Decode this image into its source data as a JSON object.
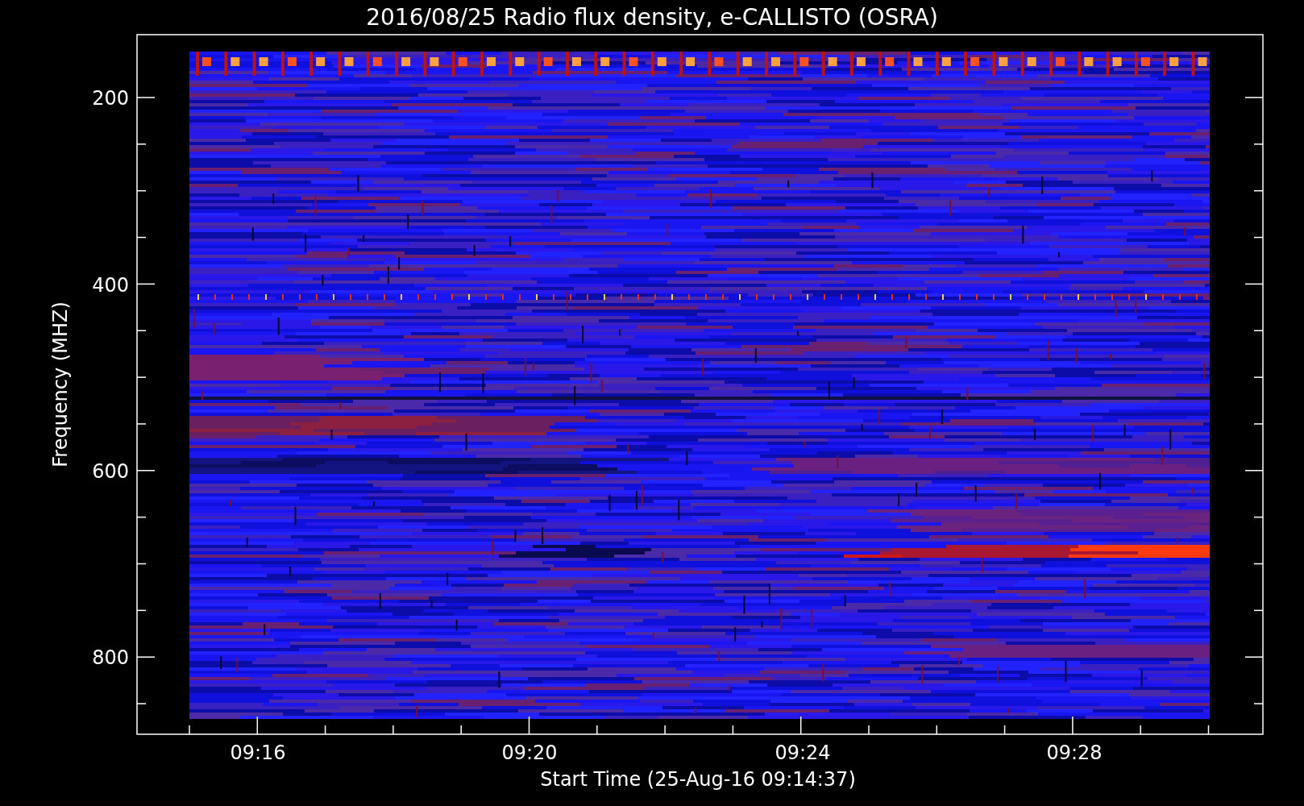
{
  "title": "2016/08/25  Radio flux density, e-CALLISTO (OSRA)",
  "y_axis": {
    "label": "Frequency (MHZ)",
    "ticks": [
      "200",
      "400",
      "600",
      "800"
    ]
  },
  "x_axis": {
    "label": "Start Time (25-Aug-16 09:14:37)",
    "ticks": [
      "09:16",
      "09:20",
      "09:24",
      "09:28"
    ]
  }
}
